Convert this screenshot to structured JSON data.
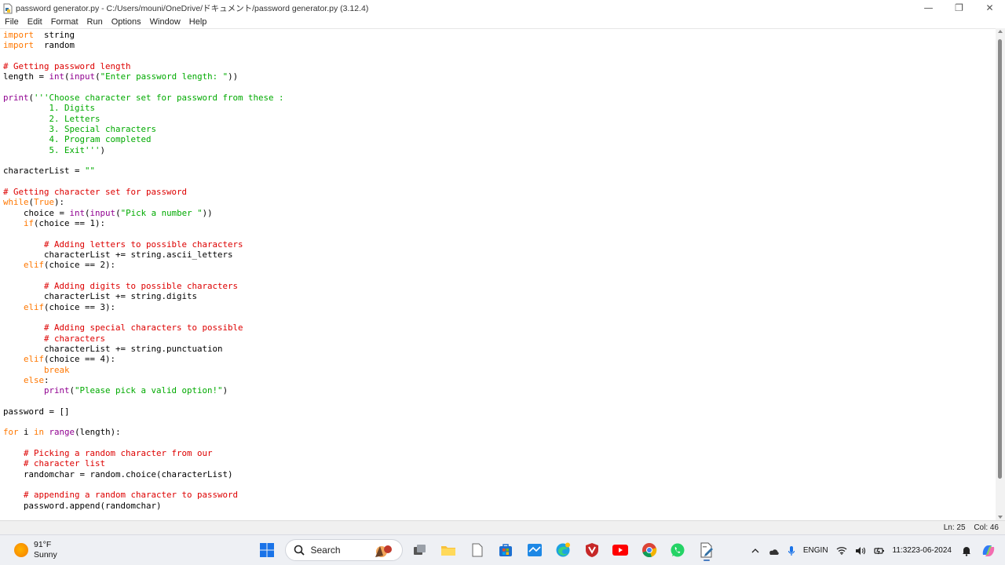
{
  "window": {
    "title": "password generator.py - C:/Users/mouni/OneDrive/ドキュメント/password generator.py (3.12.4)",
    "controls": {
      "minimize": "—",
      "restore": "❐",
      "close": "✕"
    }
  },
  "menu": [
    "File",
    "Edit",
    "Format",
    "Run",
    "Options",
    "Window",
    "Help"
  ],
  "editor": {
    "lines": [
      [
        [
          "kw",
          "import"
        ],
        [
          "",
          "  string"
        ]
      ],
      [
        [
          "kw",
          "import"
        ],
        [
          "",
          "  random"
        ]
      ],
      [],
      [
        [
          "cm",
          "# Getting password length"
        ]
      ],
      [
        [
          "",
          "length = "
        ],
        [
          "bi",
          "int"
        ],
        [
          "",
          "("
        ],
        [
          "bi",
          "input"
        ],
        [
          "",
          "("
        ],
        [
          "st",
          "\"Enter password length: \""
        ],
        [
          "",
          "))"
        ]
      ],
      [],
      [
        [
          "bi",
          "print"
        ],
        [
          "",
          "("
        ],
        [
          "st",
          "'''Choose character set for password from these :"
        ]
      ],
      [
        [
          "st",
          "         1. Digits"
        ]
      ],
      [
        [
          "st",
          "         2. Letters"
        ]
      ],
      [
        [
          "st",
          "         3. Special characters"
        ]
      ],
      [
        [
          "st",
          "         4. Program completed"
        ]
      ],
      [
        [
          "st",
          "         5. Exit'''"
        ],
        [
          "",
          ")"
        ]
      ],
      [],
      [
        [
          "",
          "characterList = "
        ],
        [
          "st",
          "\"\""
        ]
      ],
      [],
      [
        [
          "cm",
          "# Getting character set for password"
        ]
      ],
      [
        [
          "kw",
          "while"
        ],
        [
          "",
          "("
        ],
        [
          "kw",
          "True"
        ],
        [
          "",
          "):"
        ]
      ],
      [
        [
          "",
          "    choice = "
        ],
        [
          "bi",
          "int"
        ],
        [
          "",
          "("
        ],
        [
          "bi",
          "input"
        ],
        [
          "",
          "("
        ],
        [
          "st",
          "\"Pick a number \""
        ],
        [
          "",
          "))"
        ]
      ],
      [
        [
          "",
          "    "
        ],
        [
          "kw",
          "if"
        ],
        [
          "",
          "(choice == 1):"
        ]
      ],
      [],
      [
        [
          "",
          "        "
        ],
        [
          "cm",
          "# Adding letters to possible characters"
        ]
      ],
      [
        [
          "",
          "        characterList += string.ascii_letters"
        ]
      ],
      [
        [
          "",
          "    "
        ],
        [
          "kw",
          "elif"
        ],
        [
          "",
          "(choice == 2):"
        ]
      ],
      [],
      [
        [
          "",
          "        "
        ],
        [
          "cm",
          "# Adding digits to possible characters"
        ]
      ],
      [
        [
          "",
          "        characterList += string.digits"
        ]
      ],
      [
        [
          "",
          "    "
        ],
        [
          "kw",
          "elif"
        ],
        [
          "",
          "(choice == 3):"
        ]
      ],
      [],
      [
        [
          "",
          "        "
        ],
        [
          "cm",
          "# Adding special characters to possible"
        ]
      ],
      [
        [
          "",
          "        "
        ],
        [
          "cm",
          "# characters"
        ]
      ],
      [
        [
          "",
          "        characterList += string.punctuation"
        ]
      ],
      [
        [
          "",
          "    "
        ],
        [
          "kw",
          "elif"
        ],
        [
          "",
          "(choice == 4):"
        ]
      ],
      [
        [
          "",
          "        "
        ],
        [
          "kw",
          "break"
        ]
      ],
      [
        [
          "",
          "    "
        ],
        [
          "kw",
          "else"
        ],
        [
          "",
          ":"
        ]
      ],
      [
        [
          "",
          "        "
        ],
        [
          "bi",
          "print"
        ],
        [
          "",
          "("
        ],
        [
          "st",
          "\"Please pick a valid option!\""
        ],
        [
          "",
          ")"
        ]
      ],
      [],
      [
        [
          "",
          "password = []"
        ]
      ],
      [],
      [
        [
          "kw",
          "for"
        ],
        [
          "",
          " i "
        ],
        [
          "kw",
          "in"
        ],
        [
          "bi",
          " range"
        ],
        [
          "",
          "(length):"
        ]
      ],
      [],
      [
        [
          "",
          "    "
        ],
        [
          "cm",
          "# Picking a random character from our"
        ]
      ],
      [
        [
          "",
          "    "
        ],
        [
          "cm",
          "# character list"
        ]
      ],
      [
        [
          "",
          "    randomchar = random.choice(characterList)"
        ]
      ],
      [],
      [
        [
          "",
          "    "
        ],
        [
          "cm",
          "# appending a random character to password"
        ]
      ],
      [
        [
          "",
          "    password.append(randomchar)"
        ]
      ]
    ]
  },
  "status": {
    "line": "Ln: 25",
    "col": "Col: 46"
  },
  "taskbar": {
    "weather": {
      "temp": "91°F",
      "condition": "Sunny"
    },
    "search_label": "Search",
    "lang": {
      "top": "ENG",
      "bottom": "IN"
    },
    "clock": {
      "time": "11:32",
      "date": "23-06-2024"
    }
  },
  "colors": {
    "keyword": "#ff7700",
    "builtin": "#900090",
    "string": "#00aa00",
    "comment": "#dd0000"
  }
}
